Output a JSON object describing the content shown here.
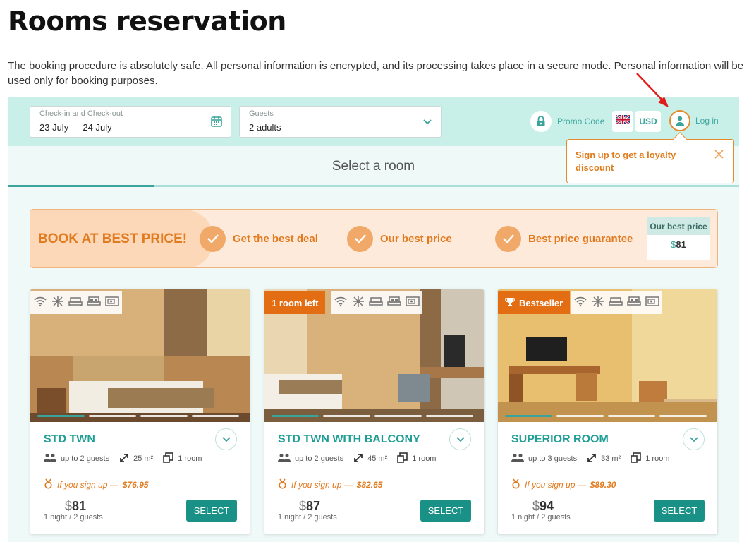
{
  "page": {
    "title": "Rooms reservation",
    "intro": "The booking procedure is absolutely safe. All personal information is encrypted, and its processing takes place in a secure mode. Personal information will be used only for booking purposes."
  },
  "booking_bar": {
    "dates_label": "Check-in and Check-out",
    "dates_value": "23 July — 24 July",
    "guests_label": "Guests",
    "guests_value": "2 adults",
    "promo_label": "Promo Code",
    "currency": "USD",
    "login_label": "Log in"
  },
  "tooltip": {
    "text": "Sign up to get a loyalty discount"
  },
  "step": {
    "title": "Select a room"
  },
  "best_price_banner": {
    "title": "BOOK AT BEST PRICE!",
    "items": [
      "Get the best deal",
      "Our best price",
      "Best price guarantee"
    ],
    "best_box_label": "Our best price",
    "best_box_currency": "$",
    "best_box_value": "81"
  },
  "rooms": [
    {
      "name": "STD TWN",
      "guests": "up to 2 guests",
      "area": "25 m²",
      "rooms": "1 room",
      "signup_text": "If you sign up —",
      "signup_price": "$76.95",
      "currency": "$",
      "price": "81",
      "per": "1 night / 2 guests",
      "select_label": "SELECT",
      "badge": ""
    },
    {
      "name": "STD TWN WITH BALCONY",
      "guests": "up to 2 guests",
      "area": "45 m²",
      "rooms": "1 room",
      "signup_text": "If you sign up —",
      "signup_price": "$82.65",
      "currency": "$",
      "price": "87",
      "per": "1 night / 2 guests",
      "select_label": "SELECT",
      "badge": "1 room left"
    },
    {
      "name": "SUPERIOR ROOM",
      "guests": "up to 3 guests",
      "area": "33 m²",
      "rooms": "1 room",
      "signup_text": "If you sign up —",
      "signup_price": "$89.30",
      "currency": "$",
      "price": "94",
      "per": "1 night / 2 guests",
      "select_label": "SELECT",
      "badge": "Bestseller"
    }
  ],
  "colors": {
    "accent": "#1a9187",
    "orange": "#e27a1e",
    "bar_bg": "#c9efe9"
  }
}
